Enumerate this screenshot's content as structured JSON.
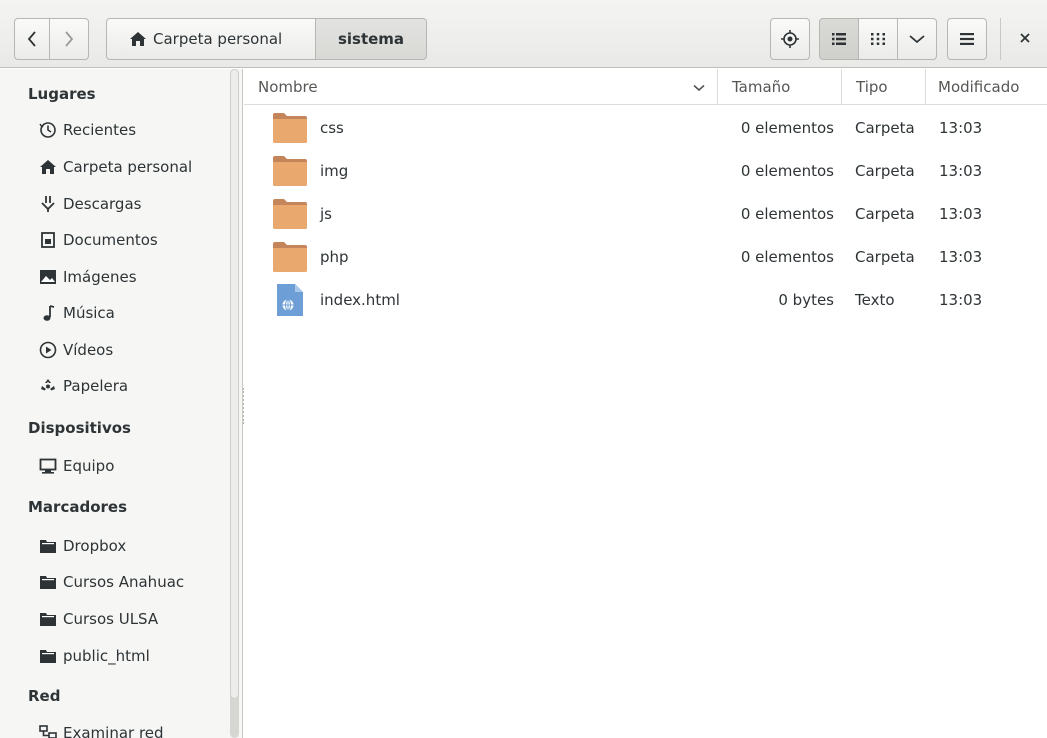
{
  "header": {
    "breadcrumbs": [
      {
        "label": "Carpeta personal",
        "icon": "home-icon"
      },
      {
        "label": "sistema"
      }
    ]
  },
  "sidebar": {
    "sections": [
      {
        "heading": "Lugares",
        "items": [
          {
            "label": "Recientes",
            "icon": "clock-icon"
          },
          {
            "label": "Carpeta personal",
            "icon": "home-icon"
          },
          {
            "label": "Descargas",
            "icon": "download-icon"
          },
          {
            "label": "Documentos",
            "icon": "document-icon"
          },
          {
            "label": "Imágenes",
            "icon": "image-icon"
          },
          {
            "label": "Música",
            "icon": "music-icon"
          },
          {
            "label": "Vídeos",
            "icon": "video-icon"
          },
          {
            "label": "Papelera",
            "icon": "trash-icon"
          }
        ]
      },
      {
        "heading": "Dispositivos",
        "items": [
          {
            "label": "Equipo",
            "icon": "computer-icon"
          }
        ]
      },
      {
        "heading": "Marcadores",
        "items": [
          {
            "label": "Dropbox",
            "icon": "folder-icon"
          },
          {
            "label": "Cursos Anahuac",
            "icon": "folder-icon"
          },
          {
            "label": "Cursos ULSA",
            "icon": "folder-icon"
          },
          {
            "label": "public_html",
            "icon": "folder-icon"
          }
        ]
      },
      {
        "heading": "Red",
        "items": [
          {
            "label": "Examinar red",
            "icon": "network-icon"
          }
        ]
      }
    ]
  },
  "columns": {
    "name": "Nombre",
    "size": "Tamaño",
    "type": "Tipo",
    "modified": "Modificado"
  },
  "files": [
    {
      "name": "css",
      "size": "0 elementos",
      "type": "Carpeta",
      "modified": "13:03",
      "icon": "folder-icon"
    },
    {
      "name": "img",
      "size": "0 elementos",
      "type": "Carpeta",
      "modified": "13:03",
      "icon": "folder-icon"
    },
    {
      "name": "js",
      "size": "0 elementos",
      "type": "Carpeta",
      "modified": "13:03",
      "icon": "folder-icon"
    },
    {
      "name": "php",
      "size": "0 elementos",
      "type": "Carpeta",
      "modified": "13:03",
      "icon": "folder-icon"
    },
    {
      "name": "index.html",
      "size": "0 bytes",
      "type": "Texto",
      "modified": "13:03",
      "icon": "html-file-icon"
    }
  ],
  "colors": {
    "folder": "#e8a86e",
    "html_file": "#6d9fd6",
    "header_bg": "#ececea",
    "sidebar_bg": "#f6f6f5"
  }
}
